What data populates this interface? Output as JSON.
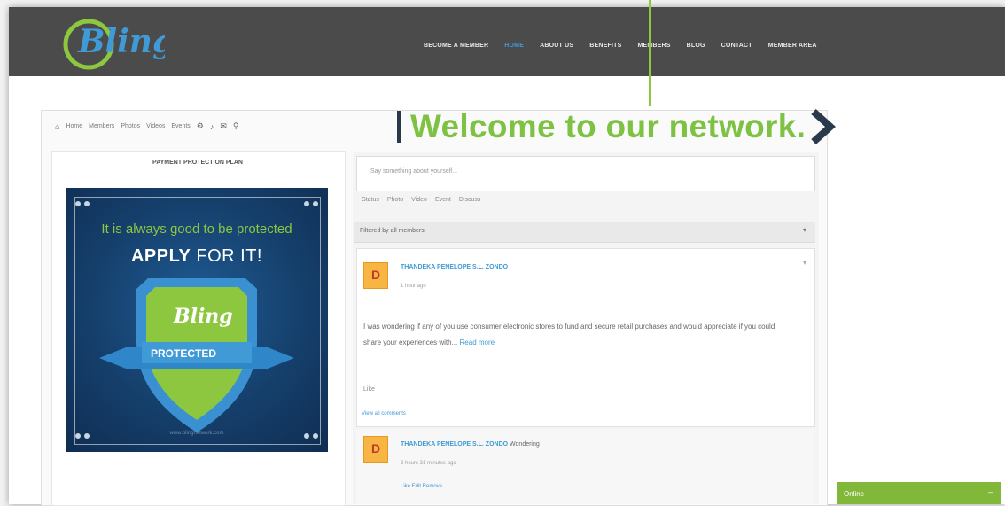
{
  "header": {
    "logo_text": "Bling",
    "logo_sub": "",
    "nav": [
      "BECOME A MEMBER",
      "HOME",
      "ABOUT US",
      "BENEFITS",
      "MEMBERS",
      "BLOG",
      "CONTACT",
      "MEMBER AREA"
    ],
    "active_nav": "HOME"
  },
  "hero": {
    "headline": "Welcome to our network."
  },
  "subnav": {
    "items": [
      "Home",
      "Members",
      "Photos",
      "Videos",
      "Events"
    ]
  },
  "left": {
    "title": "PAYMENT PROTECTION PLAN",
    "promo_line1": "It is always good to be protected",
    "promo_apply": "APPLY",
    "promo_rest": " FOR IT!",
    "shield_logo": "Bling",
    "ribbon": "PROTECTED",
    "footer": "www.blingnetwork.com"
  },
  "feed": {
    "post_placeholder": "Say something about yourself...",
    "actions": [
      "Status",
      "Photo",
      "Video",
      "Event",
      "Discuss"
    ],
    "filter_label": "Filtered by all members",
    "post": {
      "author": "THANDEKA PENELOPE S.L. ZONDO",
      "time": "1 hour ago",
      "body": "I was wondering if any of you use consumer electronic stores to fund and secure retail purchases and would appreciate if you could share your experiences with...",
      "read_more": "Read more",
      "like": "Like",
      "view_all": "View all comments"
    },
    "comment": {
      "author": "THANDEKA PENELOPE S.L. ZONDO",
      "text": "Wondering",
      "time": "3 hours 31 minutes ago",
      "actions": "Like Edit Remove"
    }
  },
  "chat": {
    "label": "Online"
  },
  "colors": {
    "brand_green": "#8dc63f",
    "brand_blue": "#3f9ad6",
    "header_bg": "#4b4b4b"
  }
}
